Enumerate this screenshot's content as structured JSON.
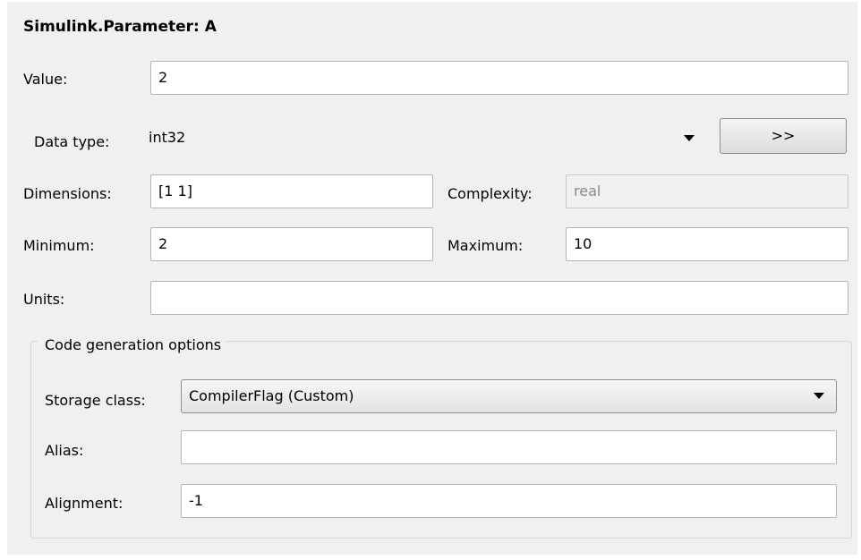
{
  "title": "Simulink.Parameter: A",
  "value": {
    "label": "Value:",
    "input": "2"
  },
  "data_type": {
    "label": "Data type:",
    "selected": "int32",
    "button_label": ">>"
  },
  "dimensions": {
    "label": "Dimensions:",
    "input": "[1 1]"
  },
  "complexity": {
    "label": "Complexity:",
    "input": "real"
  },
  "minimum": {
    "label": "Minimum:",
    "input": "2"
  },
  "maximum": {
    "label": "Maximum:",
    "input": "10"
  },
  "units": {
    "label": "Units:",
    "input": ""
  },
  "code_gen": {
    "legend": "Code generation options",
    "storage_class": {
      "label": "Storage class:",
      "selected": "CompilerFlag (Custom)"
    },
    "alias": {
      "label": "Alias:",
      "input": ""
    },
    "alignment": {
      "label": "Alignment:",
      "input": "-1"
    }
  },
  "icons": {
    "dropdown": "chevron-down-icon"
  }
}
